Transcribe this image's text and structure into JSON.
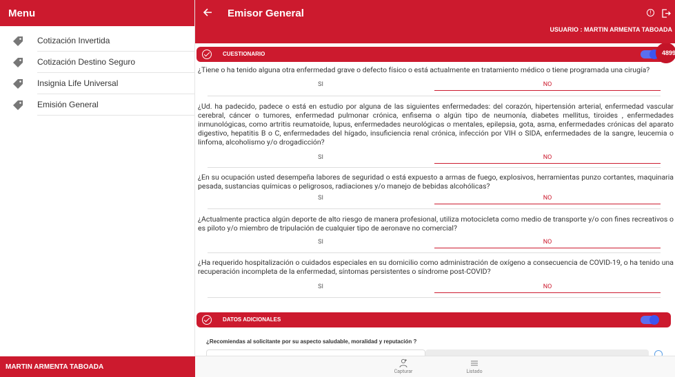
{
  "sidebar": {
    "title": "Menu",
    "items": [
      {
        "label": "Cotización Invertida"
      },
      {
        "label": "Cotización Destino Seguro"
      },
      {
        "label": "Insignia Life Universal"
      },
      {
        "label": "Emisión General"
      }
    ],
    "footer_user": "MARTIN ARMENTA TABOADA"
  },
  "header": {
    "title": "Emisor General",
    "user_line": "USUARIO : MARTIN ARMENTA TABOADA"
  },
  "cuestionario": {
    "title": "CUESTIONARIO",
    "badge": "4899",
    "toggle_on": true,
    "answer_labels": {
      "yes": "SI",
      "no": "NO"
    },
    "questions": [
      {
        "text": "¿Tiene o ha tenido alguna otra enfermedad grave o defecto físico o está actualmente en tratamiento médico o tiene programada una cirugía?",
        "selected": "NO"
      },
      {
        "text": "¿Ud. ha padecido, padece o está en estudio por alguna de las siguientes enfermedades: del corazón, hipertensión arterial, enfermedad vascular cerebral, cáncer o tumores, enfermedad pulmonar crónica, enfisema o algún tipo de neumonía, diabetes mellitus, tiroides , enfermedades inmunológicas, como artritis reumatoide, lupus, enfermedades neurológicas o mentales, epilepsia, gota, asma, enfermedades crónicas del aparato digestivo, hepatitis B o C, enfermedades del hígado, insuficiencia renal crónica, infección por VIH o SIDA, enfermedades de la sangre, leucemia o linfoma, alcoholismo y/o drogadicción?",
        "selected": "NO"
      },
      {
        "text": "¿En su ocupación usted desempeña labores de seguridad o está expuesto a armas de fuego, explosivos, herramientas punzo cortantes, maquinaria pesada, sustancias químicas o peligrosos, radiaciones y/o manejo de bebidas alcohólicas?",
        "selected": "NO"
      },
      {
        "text": "¿Actualmente practica algún deporte de alto riesgo de manera profesional, utiliza motocicleta como medio de transporte y/o con fines recreativos o es piloto y/o miembro de tripulación de cualquier tipo de aeronave no comercial?",
        "selected": "NO"
      },
      {
        "text": "¿Ha requerido hospitalización o cuidados especiales en su domicilio como administración de oxígeno a consecuencia de COVID-19, o ha tenido una recuperación incompleta de la enfermedad, síntomas persistentes o síndrome post-COVID?",
        "selected": "NO"
      }
    ]
  },
  "datos": {
    "title": "DATOS ADICIONALES",
    "toggle_on": true,
    "question": "¿Recomiendas al solicitante por su aspecto saludable, moralidad y reputación ?"
  },
  "bottom_nav": {
    "capturar": "Capturar",
    "listado": "Listado"
  },
  "colors": {
    "brand": "#cc1a2e",
    "toggle": "#3d55ef"
  }
}
